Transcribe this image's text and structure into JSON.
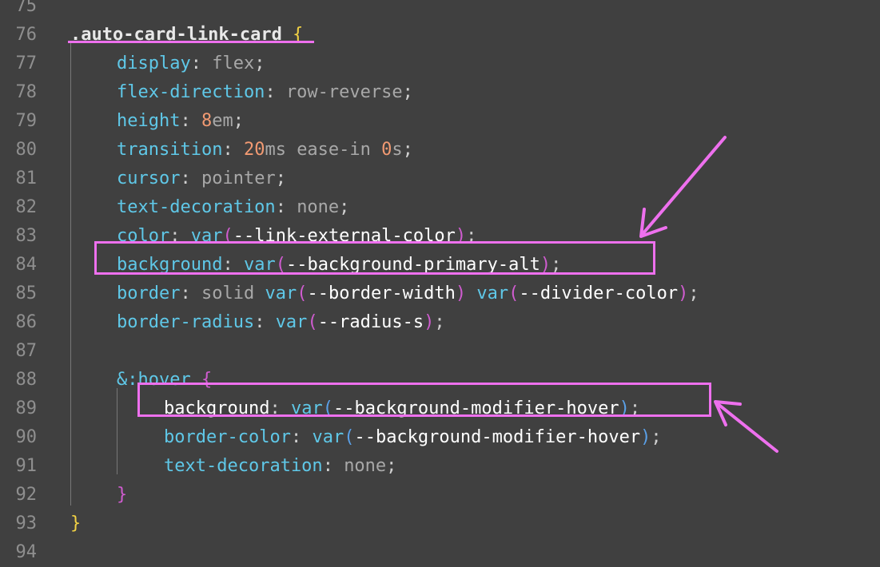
{
  "editor": {
    "lines": [
      {
        "num": "75",
        "segments": []
      },
      {
        "num": "76",
        "segments": [
          {
            "t": ".auto-card-link-card",
            "c": "sel"
          },
          {
            "t": " ",
            "c": "punc"
          },
          {
            "t": "{",
            "c": "brace1"
          }
        ]
      },
      {
        "num": "77",
        "indent": 1,
        "segments": [
          {
            "t": "display",
            "c": "prop"
          },
          {
            "t": ": ",
            "c": "punc"
          },
          {
            "t": "flex",
            "c": "val"
          },
          {
            "t": ";",
            "c": "punc"
          }
        ]
      },
      {
        "num": "78",
        "indent": 1,
        "segments": [
          {
            "t": "flex-direction",
            "c": "prop"
          },
          {
            "t": ": ",
            "c": "punc"
          },
          {
            "t": "row-reverse",
            "c": "val"
          },
          {
            "t": ";",
            "c": "punc"
          }
        ]
      },
      {
        "num": "79",
        "indent": 1,
        "segments": [
          {
            "t": "height",
            "c": "prop"
          },
          {
            "t": ": ",
            "c": "punc"
          },
          {
            "t": "8",
            "c": "num"
          },
          {
            "t": "em",
            "c": "val"
          },
          {
            "t": ";",
            "c": "punc"
          }
        ]
      },
      {
        "num": "80",
        "indent": 1,
        "segments": [
          {
            "t": "transition",
            "c": "prop"
          },
          {
            "t": ": ",
            "c": "punc"
          },
          {
            "t": "20",
            "c": "num"
          },
          {
            "t": "ms ease-in ",
            "c": "val"
          },
          {
            "t": "0",
            "c": "num"
          },
          {
            "t": "s",
            "c": "val"
          },
          {
            "t": ";",
            "c": "punc"
          }
        ]
      },
      {
        "num": "81",
        "indent": 1,
        "segments": [
          {
            "t": "cursor",
            "c": "prop"
          },
          {
            "t": ": ",
            "c": "punc"
          },
          {
            "t": "pointer",
            "c": "val"
          },
          {
            "t": ";",
            "c": "punc"
          }
        ]
      },
      {
        "num": "82",
        "indent": 1,
        "segments": [
          {
            "t": "text-decoration",
            "c": "prop"
          },
          {
            "t": ": ",
            "c": "punc"
          },
          {
            "t": "none",
            "c": "val"
          },
          {
            "t": ";",
            "c": "punc"
          }
        ]
      },
      {
        "num": "83",
        "indent": 1,
        "segments": [
          {
            "t": "color",
            "c": "prop"
          },
          {
            "t": ": ",
            "c": "punc"
          },
          {
            "t": "var",
            "c": "fn"
          },
          {
            "t": "(",
            "c": "par"
          },
          {
            "t": "--link-external-color",
            "c": "var"
          },
          {
            "t": ")",
            "c": "par"
          },
          {
            "t": ";",
            "c": "punc"
          }
        ]
      },
      {
        "num": "84",
        "indent": 1,
        "segments": [
          {
            "t": "background",
            "c": "prop"
          },
          {
            "t": ": ",
            "c": "punc"
          },
          {
            "t": "var",
            "c": "fn"
          },
          {
            "t": "(",
            "c": "par"
          },
          {
            "t": "--background-primary-alt",
            "c": "var"
          },
          {
            "t": ")",
            "c": "par"
          },
          {
            "t": ";",
            "c": "punc"
          }
        ]
      },
      {
        "num": "85",
        "indent": 1,
        "segments": [
          {
            "t": "border",
            "c": "prop"
          },
          {
            "t": ": ",
            "c": "punc"
          },
          {
            "t": "solid ",
            "c": "val"
          },
          {
            "t": "var",
            "c": "fn"
          },
          {
            "t": "(",
            "c": "par"
          },
          {
            "t": "--border-width",
            "c": "var"
          },
          {
            "t": ")",
            "c": "par"
          },
          {
            "t": " ",
            "c": "punc"
          },
          {
            "t": "var",
            "c": "fn"
          },
          {
            "t": "(",
            "c": "par"
          },
          {
            "t": "--divider-color",
            "c": "var"
          },
          {
            "t": ")",
            "c": "par"
          },
          {
            "t": ";",
            "c": "punc"
          }
        ]
      },
      {
        "num": "86",
        "indent": 1,
        "segments": [
          {
            "t": "border-radius",
            "c": "prop"
          },
          {
            "t": ": ",
            "c": "punc"
          },
          {
            "t": "var",
            "c": "fn"
          },
          {
            "t": "(",
            "c": "par"
          },
          {
            "t": "--radius-s",
            "c": "var"
          },
          {
            "t": ")",
            "c": "par"
          },
          {
            "t": ";",
            "c": "punc"
          }
        ]
      },
      {
        "num": "87",
        "segments": []
      },
      {
        "num": "88",
        "indent": 1,
        "segments": [
          {
            "t": "&:hover",
            "c": "prop"
          },
          {
            "t": " ",
            "c": "punc"
          },
          {
            "t": "{",
            "c": "brace2"
          }
        ]
      },
      {
        "num": "89",
        "indent": 2,
        "segments": [
          {
            "t": "background",
            "c": "propw"
          },
          {
            "t": ": ",
            "c": "punc"
          },
          {
            "t": "var",
            "c": "fn"
          },
          {
            "t": "(",
            "c": "parb"
          },
          {
            "t": "--background-modifier-hover",
            "c": "var"
          },
          {
            "t": ")",
            "c": "parb"
          },
          {
            "t": ";",
            "c": "punc"
          }
        ]
      },
      {
        "num": "90",
        "indent": 2,
        "segments": [
          {
            "t": "border-color",
            "c": "prop"
          },
          {
            "t": ": ",
            "c": "punc"
          },
          {
            "t": "var",
            "c": "fn"
          },
          {
            "t": "(",
            "c": "parb"
          },
          {
            "t": "--background-modifier-hover",
            "c": "var"
          },
          {
            "t": ")",
            "c": "parb"
          },
          {
            "t": ";",
            "c": "punc"
          }
        ]
      },
      {
        "num": "91",
        "indent": 2,
        "segments": [
          {
            "t": "text-decoration",
            "c": "prop"
          },
          {
            "t": ": ",
            "c": "punc"
          },
          {
            "t": "none",
            "c": "val"
          },
          {
            "t": ";",
            "c": "punc"
          }
        ]
      },
      {
        "num": "92",
        "indent": 1,
        "segments": [
          {
            "t": "}",
            "c": "brace2"
          }
        ]
      },
      {
        "num": "93",
        "segments": [
          {
            "t": "}",
            "c": "brace1"
          }
        ]
      },
      {
        "num": "94",
        "segments": []
      }
    ]
  },
  "colors": {
    "background": "#404040",
    "annotation": "#ee70ee",
    "property": "#5fc8e8",
    "number": "#f29a72",
    "outer_brace": "#f2d244",
    "inner_brace": "#d05cd0"
  },
  "annotations": {
    "underline_target": "selector",
    "boxes": [
      "highlight-box-line-84",
      "highlight-box-line-89"
    ],
    "arrows": [
      "arrow-to-line-84",
      "arrow-to-line-89"
    ]
  }
}
